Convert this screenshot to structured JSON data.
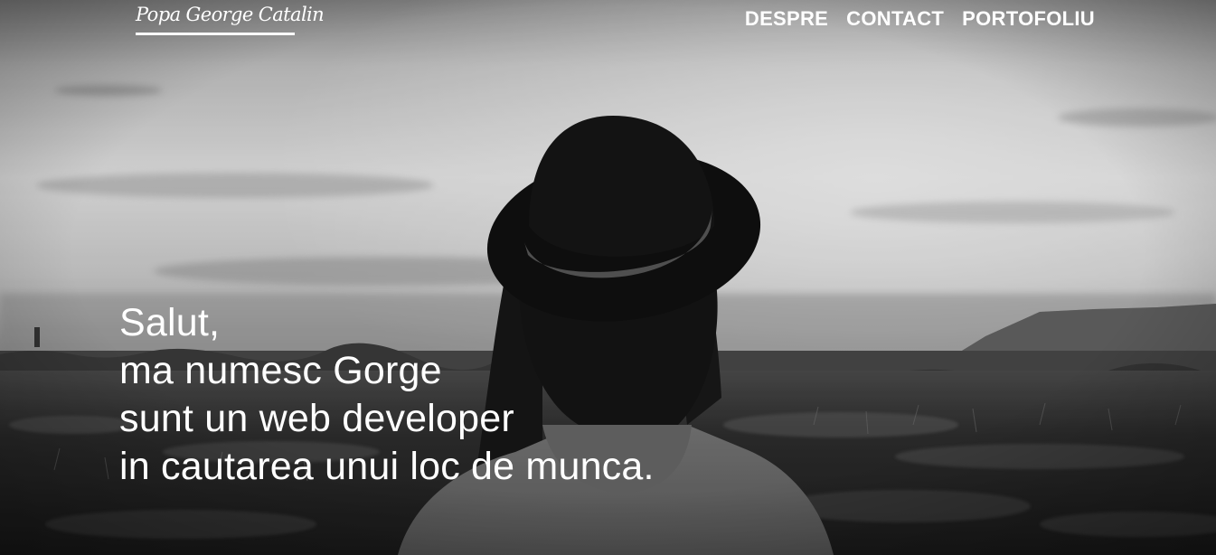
{
  "header": {
    "logo_text": "Popa George Catalin",
    "nav": [
      {
        "label": "DESPRE"
      },
      {
        "label": "CONTACT"
      },
      {
        "label": "PORTOFOLIU"
      }
    ]
  },
  "hero": {
    "lines": [
      "Salut,",
      "ma numesc Gorge",
      "sunt un web developer",
      "in cautarea unui loc de munca."
    ],
    "image": "black-and-white photo of a woman in a hat facing a field and mountain"
  },
  "colors": {
    "text": "#ffffff",
    "sky": "#e8e8e8",
    "field": "#2a2a2a"
  }
}
